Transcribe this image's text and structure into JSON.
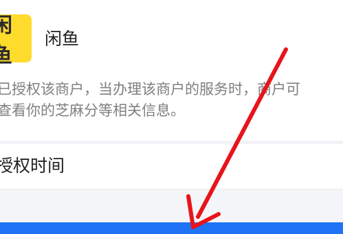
{
  "merchant": {
    "logo_text": "闲鱼",
    "name": "闲鱼"
  },
  "description": {
    "line1": "已授权该商户，当办理该商户的服务时，商户可",
    "line2": "查看你的芝麻分等相关信息。"
  },
  "auth_row": {
    "label": "授权时间",
    "value": ""
  },
  "colors": {
    "logo_yellow": "#ffdb2c",
    "annotation_red": "#e8141b",
    "button_blue": "#1e74f5"
  },
  "icons": {
    "annotation": "red-arrow-icon"
  }
}
